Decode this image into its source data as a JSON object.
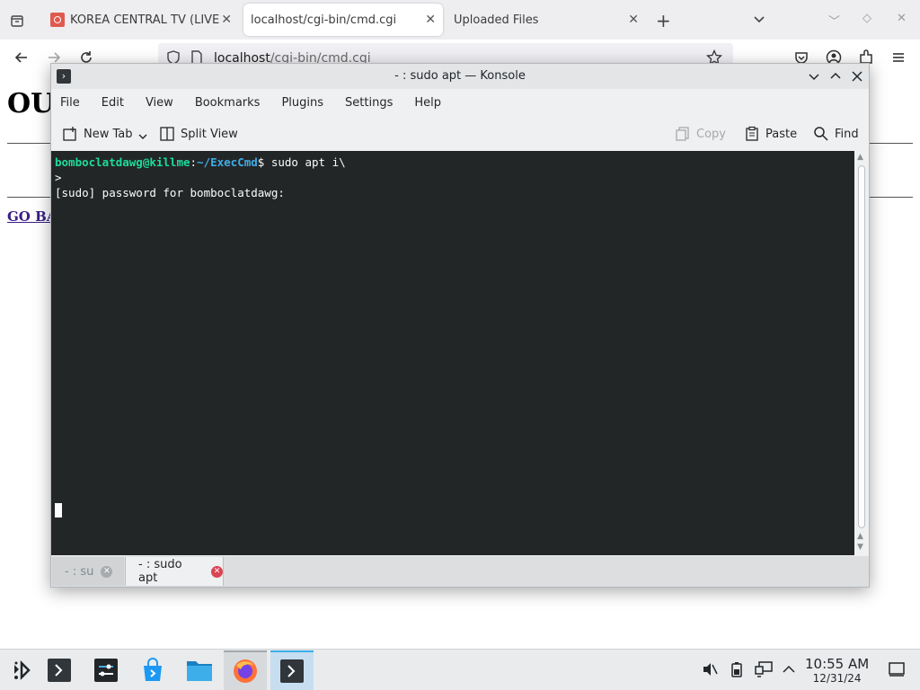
{
  "browser": {
    "tabs": [
      {
        "label": "KOREA CENTRAL TV (LIVE",
        "active": false
      },
      {
        "label": "localhost/cgi-bin/cmd.cgi",
        "active": true
      },
      {
        "label": "Uploaded Files",
        "active": false
      }
    ],
    "url_host": "localhost",
    "url_path": "/cgi-bin/cmd.cgi"
  },
  "page": {
    "heading": "OU",
    "link": "GO BA"
  },
  "konsole": {
    "title": "- : sudo apt — Konsole",
    "menu": [
      "File",
      "Edit",
      "View",
      "Bookmarks",
      "Plugins",
      "Settings",
      "Help"
    ],
    "toolbar": {
      "new_tab": "New Tab",
      "split_view": "Split View",
      "copy": "Copy",
      "paste": "Paste",
      "find": "Find"
    },
    "terminal": {
      "user_host": "bomboclatdawg@killme",
      "cwd": "~/ExecCmd",
      "command": "$ sudo apt i\\",
      "line2": ">",
      "line3": "[sudo] password for bomboclatdawg:"
    },
    "tabs": [
      {
        "label": "- : su",
        "active": false
      },
      {
        "label": "- : sudo apt",
        "active": true
      }
    ]
  },
  "taskbar": {
    "time": "10:55 AM",
    "date": "12/31/24"
  },
  "colors": {
    "terminal_bg": "#232627",
    "prompt_user": "#1cdc9a",
    "prompt_cwd": "#3daee9",
    "accent": "#3daee9",
    "close_red": "#da4453"
  }
}
